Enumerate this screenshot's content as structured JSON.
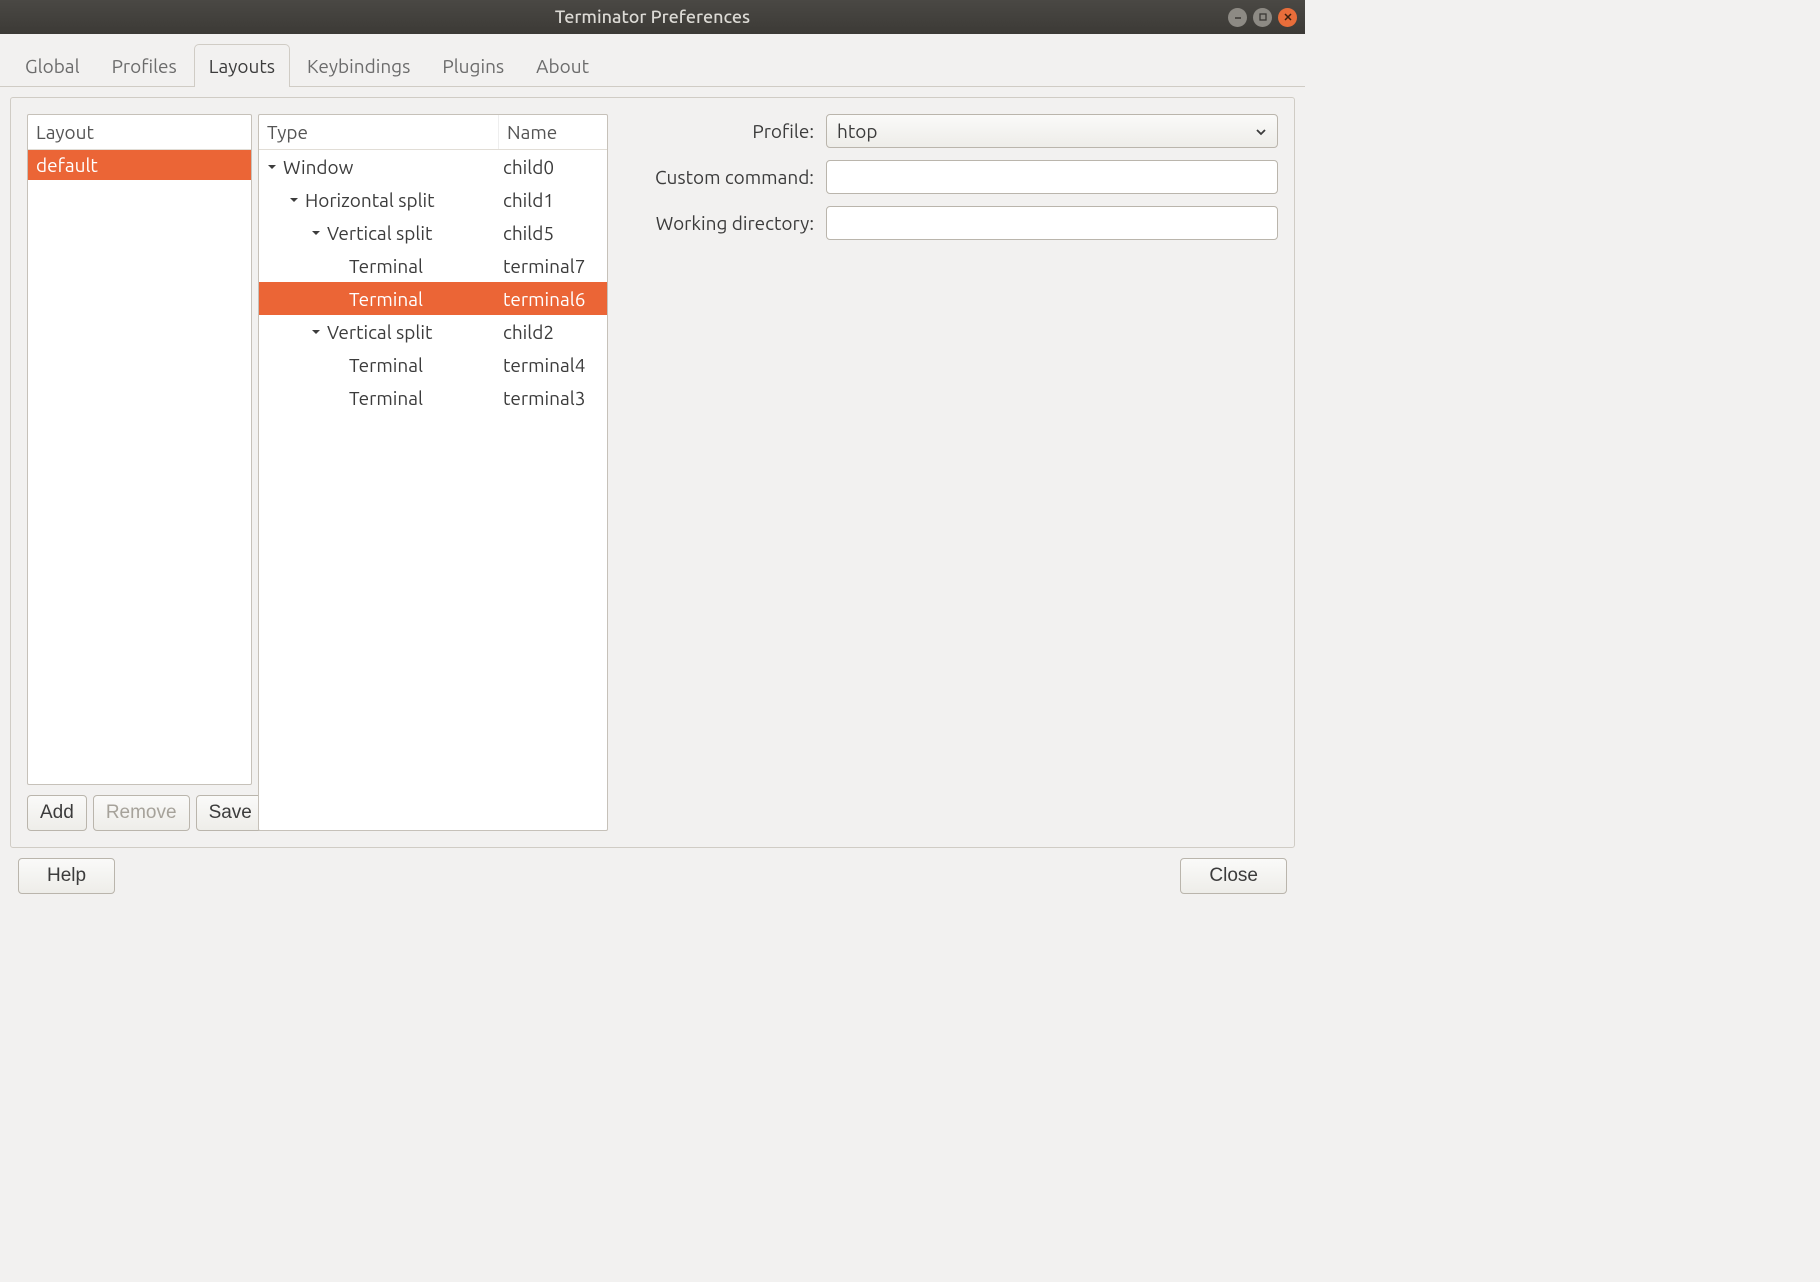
{
  "window": {
    "title": "Terminator Preferences"
  },
  "tabs": [
    "Global",
    "Profiles",
    "Layouts",
    "Keybindings",
    "Plugins",
    "About"
  ],
  "active_tab_index": 2,
  "layout_header": "Layout",
  "layouts": [
    "default"
  ],
  "selected_layout_index": 0,
  "buttons": {
    "add": "Add",
    "remove": "Remove",
    "save": "Save",
    "help": "Help",
    "close": "Close"
  },
  "tree": {
    "headers": {
      "type": "Type",
      "name": "Name"
    },
    "rows": [
      {
        "depth": 0,
        "expander": true,
        "type": "Window",
        "name": "child0",
        "selected": false
      },
      {
        "depth": 1,
        "expander": true,
        "type": "Horizontal split",
        "name": "child1",
        "selected": false
      },
      {
        "depth": 2,
        "expander": true,
        "type": "Vertical split",
        "name": "child5",
        "selected": false
      },
      {
        "depth": 3,
        "expander": false,
        "type": "Terminal",
        "name": "terminal7",
        "selected": false
      },
      {
        "depth": 3,
        "expander": false,
        "type": "Terminal",
        "name": "terminal6",
        "selected": true
      },
      {
        "depth": 2,
        "expander": true,
        "type": "Vertical split",
        "name": "child2",
        "selected": false
      },
      {
        "depth": 3,
        "expander": false,
        "type": "Terminal",
        "name": "terminal4",
        "selected": false
      },
      {
        "depth": 3,
        "expander": false,
        "type": "Terminal",
        "name": "terminal3",
        "selected": false
      }
    ]
  },
  "props": {
    "profile_label": "Profile:",
    "profile_value": "htop",
    "custom_command_label": "Custom command:",
    "custom_command_value": "",
    "working_directory_label": "Working directory:",
    "working_directory_value": ""
  }
}
